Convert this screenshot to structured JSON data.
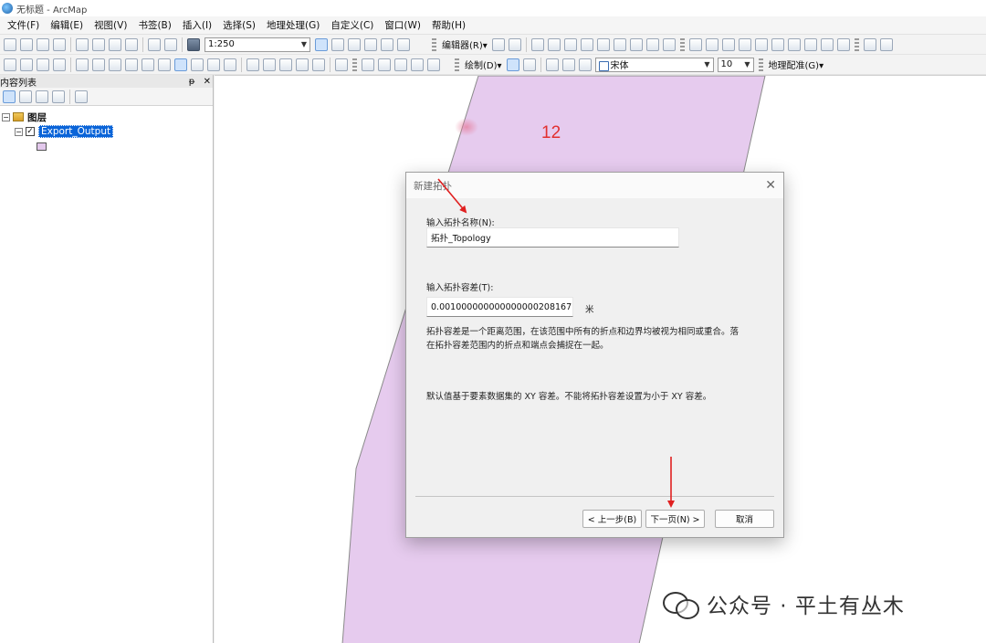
{
  "window": {
    "title": "无标题 - ArcMap"
  },
  "menu": [
    "文件(F)",
    "编辑(E)",
    "视图(V)",
    "书签(B)",
    "插入(I)",
    "选择(S)",
    "地理处理(G)",
    "自定义(C)",
    "窗口(W)",
    "帮助(H)"
  ],
  "toolbar": {
    "scale_value": "1:250",
    "editor_label": "编辑器(R)▾",
    "draw_label": "绘制(D)▾",
    "font_name": "宋体",
    "font_size": "10",
    "georef_label": "地理配准(G)▾"
  },
  "toc": {
    "title": "内容列表",
    "pin_glyph": "ᵽ",
    "close_glyph": "✕",
    "layers_label": "图层",
    "layer_name": "Export_Output"
  },
  "map": {
    "label": "12",
    "fill_color": "#e6cbee",
    "outline_color": "#8a8a8a"
  },
  "dialog": {
    "title": "新建拓扑",
    "close_glyph": "✕",
    "name_label": "输入拓扑名称(N):",
    "name_value": "拓扑_Topology",
    "tolerance_label": "输入拓扑容差(T):",
    "tolerance_value": "0.001000000000000000208167",
    "unit": "米",
    "desc_line1": "拓扑容差是一个距离范围，在该范围中所有的折点和边界均被视为相同或重合。落",
    "desc_line2": "在拓扑容差范围内的折点和端点会捕捉在一起。",
    "default_note": "默认值基于要素数据集的 XY 容差。不能将拓扑容差设置为小于 XY 容差。",
    "back_button": "< 上一步(B)",
    "next_button": "下一页(N) >",
    "cancel_button": "取消"
  },
  "annotation": {
    "arrow_color": "#e02020"
  },
  "watermark": {
    "text": "公众号 · 平土有丛木"
  }
}
